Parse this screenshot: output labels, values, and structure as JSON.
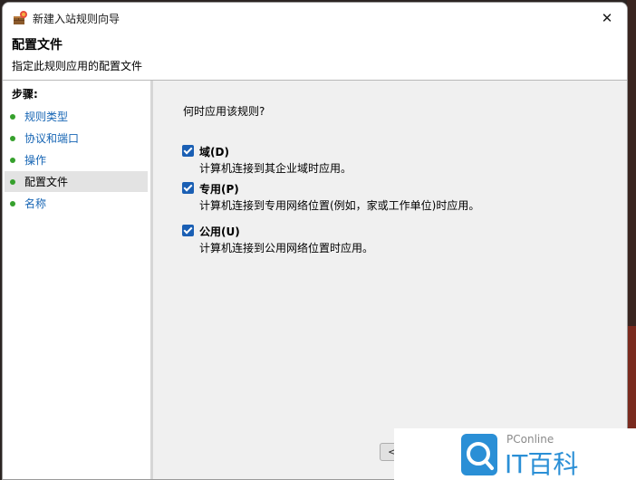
{
  "window": {
    "title": "新建入站规则向导",
    "close_glyph": "✕"
  },
  "header": {
    "title": "配置文件",
    "subtitle": "指定此规则应用的配置文件"
  },
  "sidebar": {
    "steps_label": "步骤:",
    "items": [
      {
        "label": "规则类型"
      },
      {
        "label": "协议和端口"
      },
      {
        "label": "操作"
      },
      {
        "label": "配置文件"
      },
      {
        "label": "名称"
      }
    ],
    "active_index": 3
  },
  "main": {
    "question": "何时应用该规则?",
    "options": [
      {
        "title": "域(D)",
        "description": "计算机连接到其企业域时应用。",
        "checked": true
      },
      {
        "title": "专用(P)",
        "description": "计算机连接到专用网络位置(例如，家或工作单位)时应用。",
        "checked": true
      },
      {
        "title": "公用(U)",
        "description": "计算机连接到公用网络位置时应用。",
        "checked": true
      }
    ],
    "back_label": "<"
  },
  "watermark": {
    "small": "PConline",
    "brand": "IT百科"
  },
  "colors": {
    "accent": "#1a5fb4",
    "link": "#1665b4",
    "step_dot": "#35a02c",
    "content_bg": "#f0f0f0"
  },
  "icons": {
    "app": "firewall-wizard-icon",
    "close": "close-icon",
    "step": "green-dot-icon",
    "check": "checkmark-icon"
  }
}
